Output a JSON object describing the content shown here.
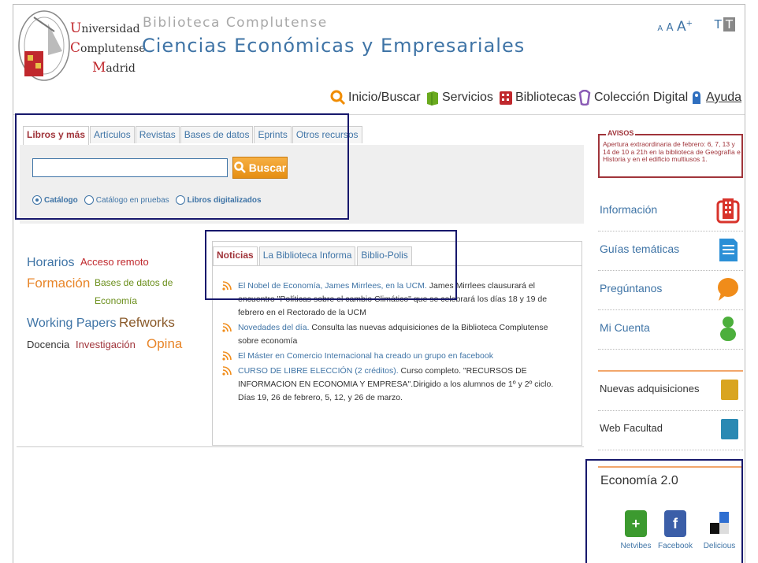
{
  "header": {
    "university_lines": [
      "Universidad",
      "Complutense",
      "Madrid"
    ],
    "library_name": "Biblioteca Complutense",
    "faculty_title": "Ciencias Económicas y Empresariales",
    "font_size_controls": [
      "A",
      "A",
      "A",
      "+"
    ],
    "text_toggle": [
      "T",
      "T"
    ]
  },
  "topnav": {
    "items": [
      {
        "label": "Inicio/Buscar",
        "icon": "search-icon",
        "color": "#f08c00"
      },
      {
        "label": "Servicios",
        "icon": "services-icon",
        "color": "#6aaa1e"
      },
      {
        "label": "Bibliotecas",
        "icon": "library-icon",
        "color": "#c0282d"
      },
      {
        "label": "Colección Digital",
        "icon": "digital-collection-icon",
        "color": "#8a5bb5"
      },
      {
        "label": "Ayuda",
        "icon": "help-icon",
        "color": "#2f6fbf"
      }
    ]
  },
  "search": {
    "tabs": [
      "Libros y más",
      "Artículos",
      "Revistas",
      "Bases de datos",
      "Eprints",
      "Otros recursos"
    ],
    "active_tab": "Libros y más",
    "input_value": "",
    "button_label": "Buscar",
    "options": [
      {
        "label": "Catálogo",
        "selected": true
      },
      {
        "label": "Catálogo en pruebas",
        "selected": false
      },
      {
        "label": "Libros digitalizados",
        "selected": false
      }
    ]
  },
  "quicklinks": {
    "horarios": "Horarios",
    "acceso_remoto": "Acceso remoto",
    "formacion": "Formación",
    "bases_datos": "Bases de datos de",
    "bases_datos2": "Economía",
    "working_papers": "Working Papers",
    "refworks": "Refworks",
    "docencia": "Docencia",
    "investigacion": "Investigación",
    "opina": "Opina"
  },
  "news": {
    "tabs": [
      "Noticias",
      "La Biblioteca Informa",
      "Biblio-Polis"
    ],
    "active_tab": "Noticias",
    "items": [
      {
        "link": "El Nobel de Economía, James Mirrlees, en la UCM.",
        "text": " James Mirrlees clausurará el encuentro \"Políticas sobre el cambio Climático\" que se celebrará los días 18 y 19 de febrero en el Rectorado de la UCM"
      },
      {
        "link": "Novedades del día.",
        "text": " Consulta las nuevas adquisiciones de la Biblioteca Complutense sobre economía"
      },
      {
        "link": "El Máster en Comercio Internacional ha creado un grupo en facebook",
        "text": ""
      },
      {
        "link": "CURSO DE LIBRE ELECCIÓN (2 créditos).",
        "text": " Curso completo. \"RECURSOS DE INFORMACION EN ECONOMIA Y EMPRESA\".Dirigido a los alumnos de 1º y 2º ciclo. Días 19, 26 de febrero, 5, 12, y 26 de marzo."
      }
    ]
  },
  "avisos": {
    "label": "AVISOS",
    "text": "Apertura extraordinaria de febrero: 6, 7, 13 y 14 de 10 a 21h en la biblioteca de Geografía e Historia y en el edificio multiusos 1."
  },
  "sidebar": {
    "items": [
      {
        "label": "Información",
        "icon": "building-icon",
        "color": "#d8342c"
      },
      {
        "label": "Guías temáticas",
        "icon": "document-icon",
        "color": "#2b8fd6"
      },
      {
        "label": "Pregúntanos",
        "icon": "speech-bubble-icon",
        "color": "#f08c1a"
      },
      {
        "label": "Mi Cuenta",
        "icon": "user-icon",
        "color": "#4caf3c"
      }
    ],
    "secondary": [
      {
        "label": "Nuevas adquisiciones",
        "color": "#d9a520"
      },
      {
        "label": "Web Facultad",
        "color": "#2a89b3"
      }
    ]
  },
  "economia20": {
    "title": "Economía 2.0",
    "items": [
      {
        "label": "Netvibes",
        "icon": "netvibes-icon",
        "glyph": "+",
        "color": "#3c9a2f"
      },
      {
        "label": "Facebook",
        "icon": "facebook-icon",
        "glyph": "f",
        "color": "#3b5ea8"
      },
      {
        "label": "Delicious",
        "icon": "delicious-icon",
        "glyph": "",
        "color": "#2f6fd1"
      }
    ]
  }
}
